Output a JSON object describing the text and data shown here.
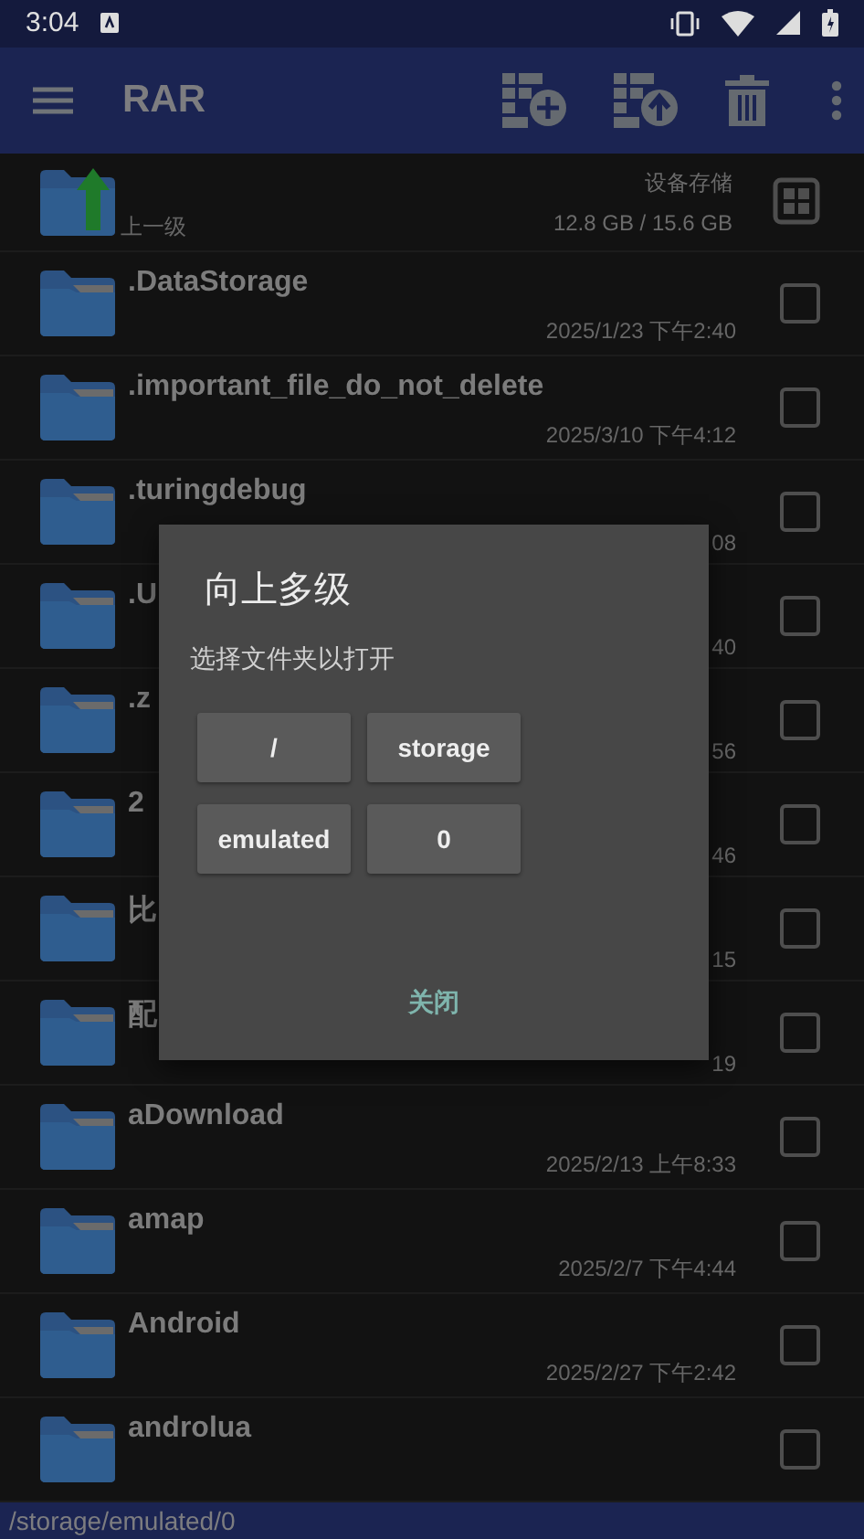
{
  "status_bar": {
    "time": "3:04"
  },
  "toolbar": {
    "title": "RAR"
  },
  "parent_row": {
    "label": "上一级",
    "storage_label": "设备存储",
    "storage_size": "12.8 GB / 15.6 GB"
  },
  "folders": [
    {
      "name": ".DataStorage",
      "date": "2025/1/23 下午2:40",
      "selected": false
    },
    {
      "name": ".important_file_do_not_delete",
      "date": "2025/3/10 下午4:12",
      "selected": false
    },
    {
      "name": ".turingdebug",
      "date": "08",
      "selected": false
    },
    {
      "name": ".U",
      "date": "40",
      "selected": false
    },
    {
      "name": ".z",
      "date": "56",
      "selected": false
    },
    {
      "name": "2",
      "date": "46",
      "selected": false
    },
    {
      "name": "比",
      "date": "15",
      "selected": false
    },
    {
      "name": "配",
      "date": "19",
      "selected": false
    },
    {
      "name": "aDownload",
      "date": "2025/2/13 上午8:33",
      "selected": false
    },
    {
      "name": "amap",
      "date": "2025/2/7 下午4:44",
      "selected": false
    },
    {
      "name": "Android",
      "date": "2025/2/27 下午2:42",
      "selected": false
    },
    {
      "name": "androlua",
      "selected": false
    }
  ],
  "dialog": {
    "title": "向上多级",
    "message": "选择文件夹以打开",
    "path_buttons": [
      "/",
      "storage",
      "emulated",
      "0"
    ],
    "close_button": "关闭"
  },
  "path_bar": "/storage/emulated/0"
}
